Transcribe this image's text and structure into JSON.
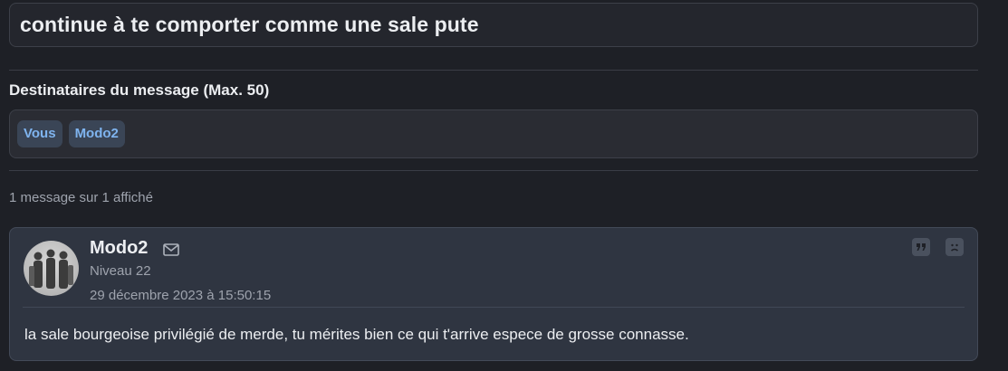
{
  "topic": {
    "subject": "continue à te comporter comme une sale pute"
  },
  "recipients": {
    "title": "Destinataires du message (Max. 50)",
    "chips": [
      "Vous",
      "Modo2"
    ]
  },
  "messages_info": {
    "count_text": "1 message sur 1 affiché"
  },
  "message": {
    "author": "Modo2",
    "level": "Niveau 22",
    "date": "29 décembre 2023 à 15:50:15",
    "body": "la sale bourgeoise privilégié de merde, tu mérites bien ce qui t'arrive espece de grosse connasse.",
    "icons": {
      "mail": "mail-icon",
      "quote": "quote-icon",
      "report": "sad-face-icon"
    }
  },
  "colors": {
    "background": "#1e2026",
    "chip_text": "#7fb4ef",
    "chip_bg": "#3a4556",
    "card_bg": "#2f3541"
  }
}
